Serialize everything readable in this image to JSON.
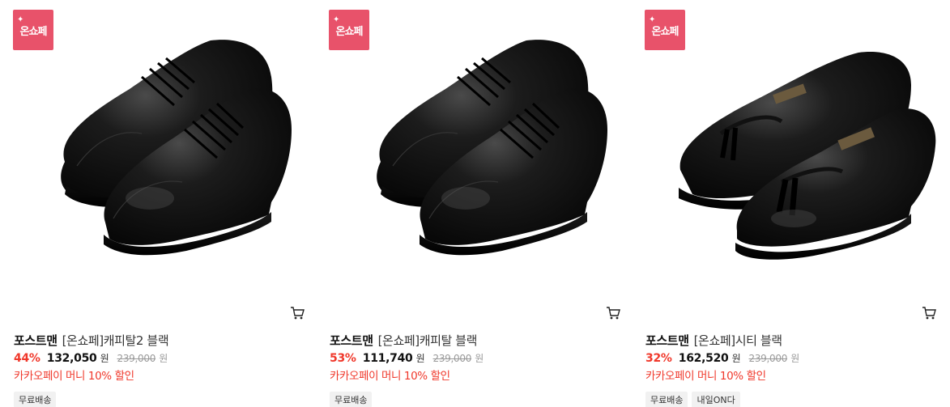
{
  "badge": {
    "label": "온쇼페",
    "color": "#e8526a"
  },
  "products": [
    {
      "brand": "포스트맨",
      "name": "[온쇼페]캐피탈2 블랙",
      "discount": "44%",
      "sale_price": "132,050",
      "sale_unit": "원",
      "original_price": "239,000",
      "original_unit": "원",
      "promo": "카카오페이 머니 10% 할인",
      "tags": [
        "무료배송"
      ],
      "image": "black-oxford-cap-toe-shoes",
      "cart_icon": "cart-icon"
    },
    {
      "brand": "포스트맨",
      "name": "[온쇼페]캐피탈 블랙",
      "discount": "53%",
      "sale_price": "111,740",
      "sale_unit": "원",
      "original_price": "239,000",
      "original_unit": "원",
      "promo": "카카오페이 머니 10% 할인",
      "tags": [
        "무료배송"
      ],
      "image": "black-oxford-cap-toe-shoes",
      "cart_icon": "cart-icon"
    },
    {
      "brand": "포스트맨",
      "name": "[온쇼페]시티 블랙",
      "discount": "32%",
      "sale_price": "162,520",
      "sale_unit": "원",
      "original_price": "239,000",
      "original_unit": "원",
      "promo": "카카오페이 머니 10% 할인",
      "tags": [
        "무료배송",
        "내일ON다"
      ],
      "image": "black-tassel-loafers",
      "cart_icon": "cart-icon"
    }
  ],
  "colors": {
    "discount": "#f0382b",
    "promo": "#f0382b",
    "tag_bg": "#f1f1f1"
  }
}
